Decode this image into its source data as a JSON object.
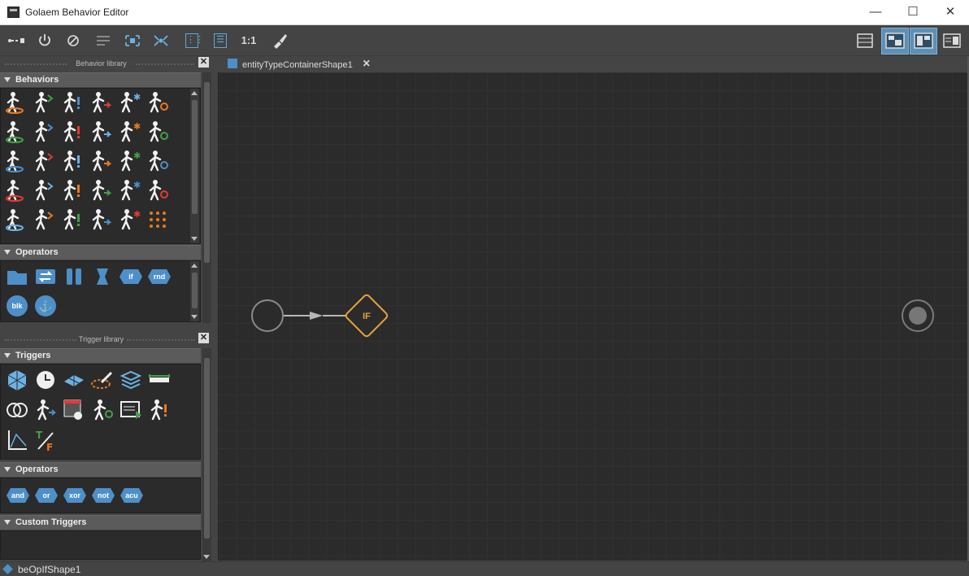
{
  "window": {
    "title": "Golaem Behavior Editor",
    "minimize": "—",
    "maximize": "☐",
    "close": "✕"
  },
  "toolbar": {
    "left_icons": [
      "connect-icon",
      "power-icon",
      "disable-icon",
      "align-icon",
      "frame-all-icon",
      "frame-selected-icon",
      "grid-layout-icon",
      "list-layout-icon"
    ],
    "ratio_label": "1:1",
    "right_icons": [
      "single-panel-icon",
      "split-panel-icon",
      "split-panel-alt-icon",
      "side-panel-icon"
    ]
  },
  "behavior_library": {
    "title": "Behavior library",
    "close": "✕",
    "behaviors_title": "Behaviors",
    "operators_title": "Operators",
    "behavior_icon_count": 30,
    "operators": [
      "",
      "",
      "",
      "",
      "if",
      "rnd",
      "blk",
      ""
    ]
  },
  "trigger_library": {
    "title": "Trigger library",
    "close": "✕",
    "triggers_title": "Triggers",
    "operators_title": "Operators",
    "operators": [
      "and",
      "or",
      "xor",
      "not",
      "acu"
    ],
    "custom_title": "Custom Triggers"
  },
  "tab": {
    "label": "entityTypeContainerShape1",
    "close": "✕"
  },
  "graph": {
    "node_if_label": "IF"
  },
  "statusbar": {
    "text": "beOpIfShape1"
  },
  "colors": {
    "accent_blue": "#4d8fc9",
    "node_orange": "#e8a33a",
    "toolbar_selected": "#5d90b6"
  }
}
